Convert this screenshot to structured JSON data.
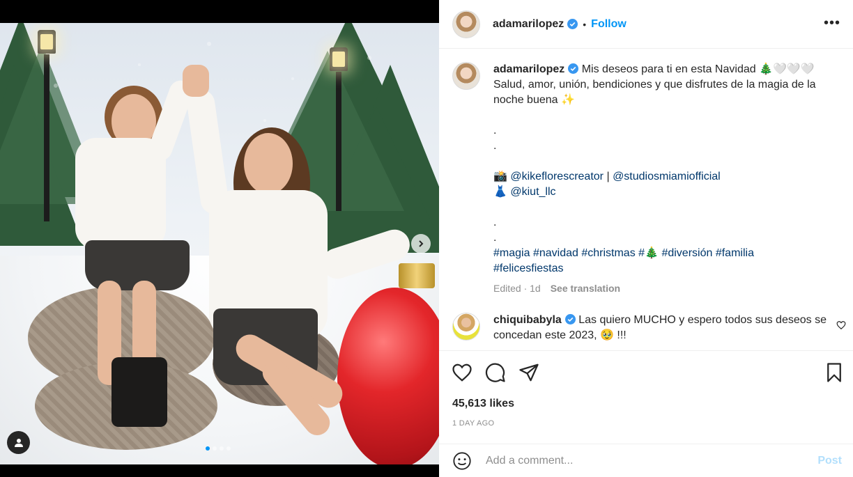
{
  "post": {
    "author": "adamarilopez",
    "follow_label": "Follow",
    "separator": "•",
    "more_label": "•••",
    "caption": {
      "author": "adamarilopez",
      "lines": [
        "Mis deseos para ti en esta Navidad 🎄🤍🤍🤍",
        "Salud, amor, unión, bendiciones y que disfrutes de la magia de la noche buena ✨"
      ],
      "dots": [
        ".",
        "."
      ],
      "credits": [
        {
          "prefix": "📸",
          "mention1": "@kikeflorescreator",
          "divider": "|",
          "mention2": "@studiosmiamiofficial"
        },
        {
          "prefix": "👗",
          "mention1": "@kiut_llc"
        }
      ],
      "dots2": [
        ".",
        "."
      ],
      "hashtags_line1": [
        "#magia",
        "#navidad",
        "#christmas",
        "#🎄",
        "#diversión",
        "#familia"
      ],
      "hashtags_line2": [
        "#felicesfiestas"
      ],
      "edited": "Edited · 1d",
      "see_translation": "See translation"
    },
    "comment": {
      "author": "chiquibabyla",
      "text": "Las quiero MUCHO y espero todos sus deseos se concedan este 2023, 🥹 !!!"
    },
    "likes": "45,613 likes",
    "posted_ago": "1 DAY AGO",
    "add_comment_placeholder": "Add a comment...",
    "post_label": "Post"
  },
  "colors": {
    "accent": "#0095f6",
    "hashtag": "#00376b",
    "muted": "#8e8e8e",
    "post_disabled": "#b2dffc"
  },
  "icons": [
    "verified-icon",
    "more-icon",
    "heart-icon",
    "comment-icon",
    "share-icon",
    "bookmark-icon",
    "emoji-icon",
    "user-tag-icon",
    "chevron-right-icon"
  ],
  "carousel": {
    "slides": 4,
    "active_index": 0
  }
}
